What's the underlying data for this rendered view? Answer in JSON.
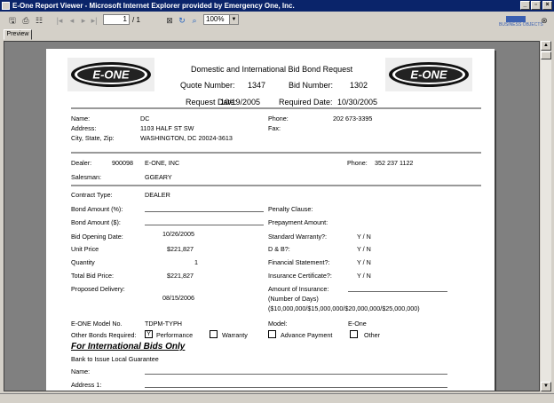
{
  "window": {
    "title": "E-One Report Viewer - Microsoft Internet Explorer provided by Emergency One, Inc."
  },
  "toolbar": {
    "page_current": "1",
    "page_total": "/ 1",
    "zoom": "100%",
    "brand_text": "BUSINESS OBJECTS"
  },
  "tab": {
    "label": "Preview"
  },
  "report": {
    "logo_text": "E-ONE",
    "title": "Domestic and International Bid Bond Request",
    "quote_number_label": "Quote Number:",
    "quote_number": "1347",
    "bid_number_label": "Bid Number:",
    "bid_number": "1302",
    "request_date_label": "Request Date:",
    "request_date": "10/19/2005",
    "required_date_label": "Required Date:",
    "required_date": "10/30/2005",
    "customer": {
      "name_label": "Name:",
      "name": "DC",
      "address_label": "Address:",
      "address": "1103 HALF ST SW",
      "csz_label": "City, State, Zip:",
      "csz": "WASHINGTON, DC 20024-3613",
      "phone_label": "Phone:",
      "phone": "202 673-3395",
      "fax_label": "Fax:"
    },
    "dealer": {
      "label": "Dealer:",
      "code": "900098",
      "name": "E-ONE, INC",
      "phone_label": "Phone:",
      "phone": "352 237 1122",
      "salesman_label": "Salesman:",
      "salesman": "GGEARY"
    },
    "contract": {
      "type_label": "Contract Type:",
      "type": "DEALER",
      "bond_pct_label": "Bond Amount (%):",
      "bond_amt_label": "Bond Amount ($):",
      "opening_date_label": "Bid Opening Date:",
      "opening_date": "10/26/2005",
      "unit_price_label": "Unit Price",
      "unit_price": "$221,827",
      "quantity_label": "Quantity",
      "quantity": "1",
      "total_label": "Total Bid Price:",
      "total": "$221,827",
      "delivery_label": "Proposed Delivery:",
      "delivery": "08/15/2006",
      "penalty_label": "Penalty Clause:",
      "prepay_label": "Prepayment Amount:",
      "warranty_label": "Standard Warranty?:",
      "db_label": "D & B?:",
      "financial_label": "Financial Statement?:",
      "insurance_cert_label": "Insurance Certificate?:",
      "yn": "Y   /   N",
      "insurance_amt_label": "Amount of Insurance:",
      "days_label": "(Number of Days)",
      "insurance_options": "($10,000,000/$15,000,000/$20,000,000/$25,000,000)",
      "model_no_label": "E-ONE Model No.",
      "model_no": "TDPM-TYPH",
      "model_label": "Model:",
      "model": "E-One",
      "other_bonds_label": "Other Bonds Required:",
      "performance_mark": "Y",
      "performance_label": "Performance",
      "warranty_bond_label": "Warranty",
      "advance_label": "Advance Payment",
      "other_label": "Other"
    },
    "international": {
      "heading": "For International Bids Only",
      "bank_label": "Bank to Issue Local Guarantee",
      "name_label": "Name:",
      "address1_label": "Address 1:"
    }
  }
}
